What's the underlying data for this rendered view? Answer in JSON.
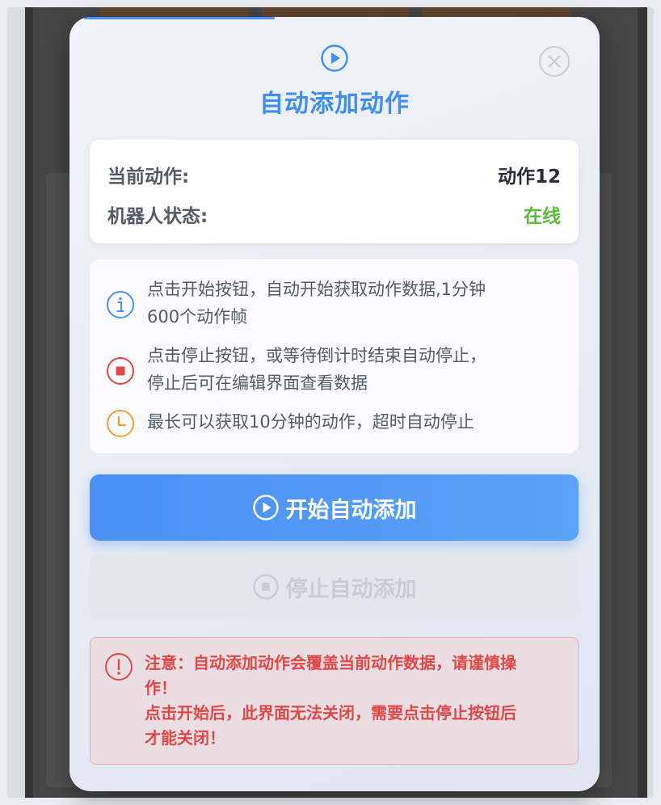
{
  "dialog": {
    "title": "自动添加动作",
    "title_icon": "play-circle-icon",
    "close_icon": "close-circle-icon",
    "accent_color": "#3f8ef1"
  },
  "status": {
    "current_action_label": "当前动作:",
    "current_action_value": "动作12",
    "robot_status_label": "机器人状态:",
    "robot_status_value": "在线",
    "online_color": "#5bbb3c"
  },
  "info": {
    "items": [
      {
        "icon": "info-icon",
        "text": "点击开始按钮，自动开始获取动作数据,1分钟\n600个动作帧",
        "color": "#4a90f5"
      },
      {
        "icon": "stop-icon",
        "text": "点击停止按钮，或等待倒计时结束自动停止，\n停止后可在编辑界面查看数据",
        "color": "#e04848"
      },
      {
        "icon": "clock-icon",
        "text": "最长可以获取10分钟的动作，超时自动停止",
        "color": "#f0a030"
      }
    ]
  },
  "buttons": {
    "start_label": "开始自动添加",
    "start_icon": "play-circle-icon",
    "stop_label": "停止自动添加",
    "stop_icon": "stop-circle-icon",
    "stop_disabled": true
  },
  "warning": {
    "icon": "exclamation-circle-icon",
    "text": "注意：自动添加动作会覆盖当前动作数据，请谨慎操\n作！\n点击开始后，此界面无法关闭，需要点击停止按钮后\n才能关闭！",
    "color": "#e04848"
  }
}
